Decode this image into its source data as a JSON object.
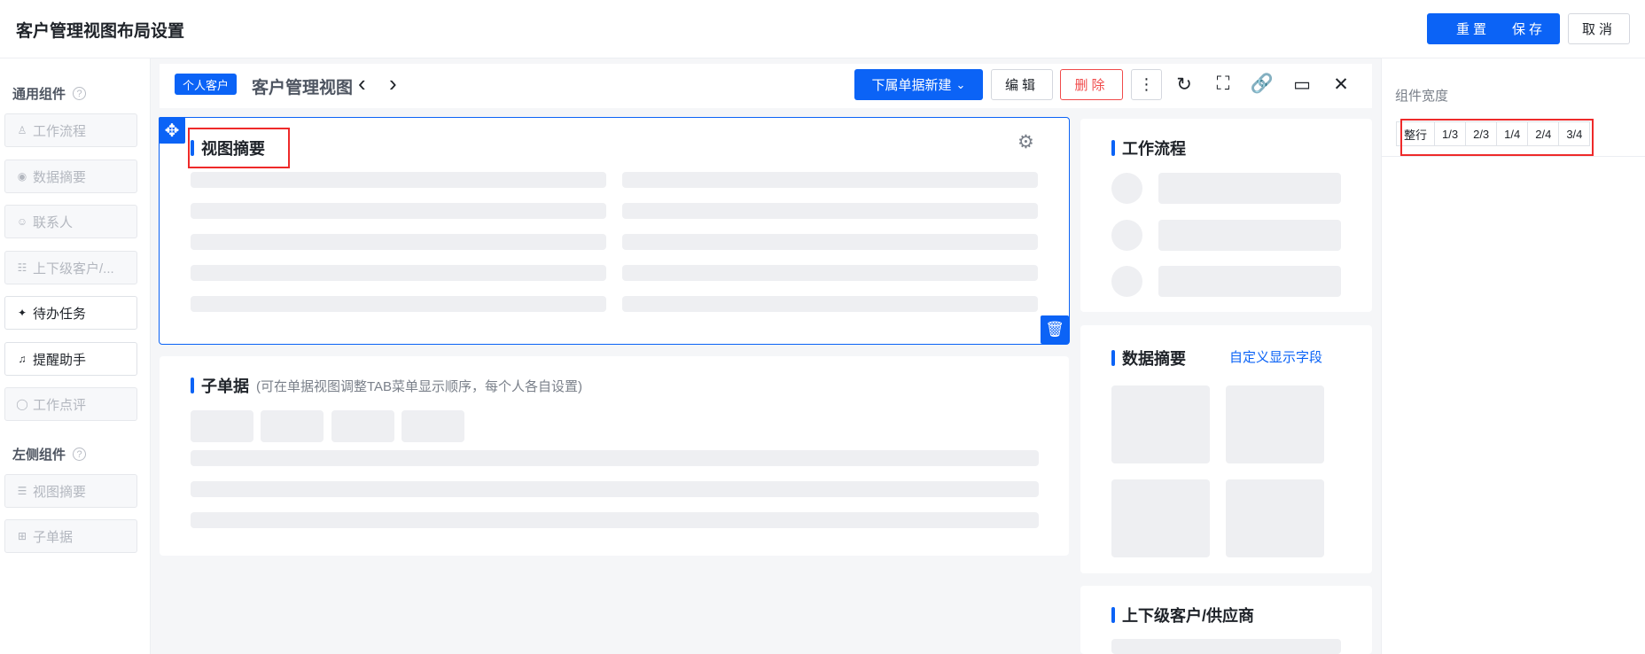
{
  "header": {
    "title": "客户管理视图布局设置",
    "reset_label": "重置",
    "save_label": "保存",
    "cancel_label": "取消"
  },
  "left_panel": {
    "general_group_title": "通用组件",
    "general_items": [
      {
        "label": "工作流程",
        "icon": "person-icon",
        "enabled": false
      },
      {
        "label": "数据摘要",
        "icon": "dot-circle-icon",
        "enabled": false
      },
      {
        "label": "联系人",
        "icon": "user-outline-icon",
        "enabled": false
      },
      {
        "label": "上下级客户/...",
        "icon": "hierarchy-icon",
        "enabled": false
      },
      {
        "label": "待办任务",
        "icon": "pin-icon",
        "enabled": true
      },
      {
        "label": "提醒助手",
        "icon": "bell-icon",
        "enabled": true
      },
      {
        "label": "工作点评",
        "icon": "comment-icon",
        "enabled": false
      }
    ],
    "side_group_title": "左侧组件",
    "side_items": [
      {
        "label": "视图摘要",
        "icon": "list-icon",
        "enabled": false
      },
      {
        "label": "子单据",
        "icon": "grid-icon",
        "enabled": false
      }
    ]
  },
  "view_header": {
    "tag": "个人客户",
    "title": "客户管理视图",
    "new_button": "下属单据新建",
    "edit_button": "编辑",
    "delete_button": "删除"
  },
  "cards": {
    "summary_title": "视图摘要",
    "sub_docs_title": "子单据",
    "sub_docs_hint": "(可在单据视图调整TAB菜单显示顺序，每个人各自设置)",
    "workflow_title": "工作流程",
    "data_summary_title": "数据摘要",
    "custom_fields_link": "自定义显示字段",
    "hierarchy_title": "上下级客户/供应商"
  },
  "right_panel": {
    "width_label": "组件宽度",
    "width_options": [
      "整行",
      "1/3",
      "2/3",
      "1/4",
      "2/4",
      "3/4"
    ]
  },
  "colors": {
    "primary": "#0b63f6",
    "danger": "#f04a4a",
    "highlight_box": "#ee2a2a"
  }
}
